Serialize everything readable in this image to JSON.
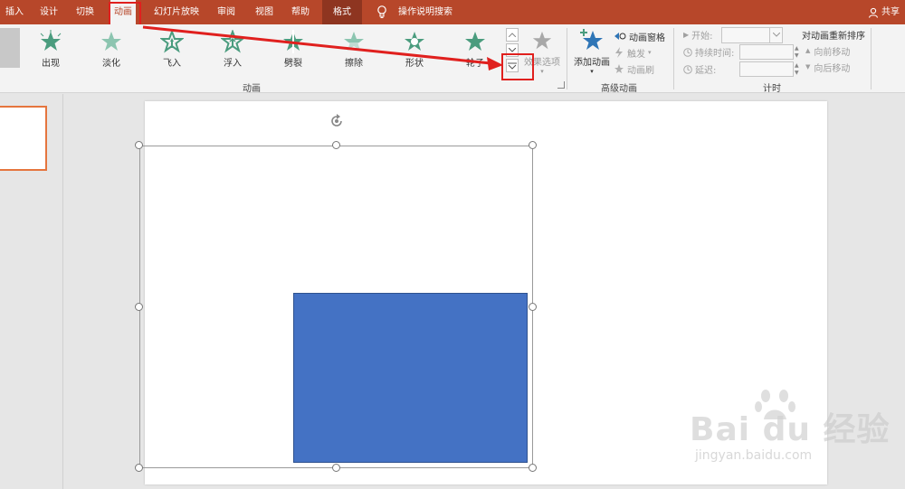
{
  "tabs": [
    {
      "label": "插入"
    },
    {
      "label": "设计"
    },
    {
      "label": "切换"
    },
    {
      "label": "动画"
    },
    {
      "label": "幻灯片放映"
    },
    {
      "label": "审阅"
    },
    {
      "label": "视图"
    },
    {
      "label": "帮助"
    },
    {
      "label": "格式"
    }
  ],
  "tell_me": "操作说明搜索",
  "share": "共享",
  "animations": [
    {
      "label": "出现",
      "icon": "appear-star-icon"
    },
    {
      "label": "淡化",
      "icon": "fade-star-icon"
    },
    {
      "label": "飞入",
      "icon": "fly-in-star-icon"
    },
    {
      "label": "浮入",
      "icon": "float-in-star-icon"
    },
    {
      "label": "劈裂",
      "icon": "split-star-icon"
    },
    {
      "label": "擦除",
      "icon": "wipe-star-icon"
    },
    {
      "label": "形状",
      "icon": "shape-star-icon"
    },
    {
      "label": "轮子",
      "icon": "wheel-star-icon"
    }
  ],
  "effect_options": "效果选项",
  "group_animation": "动画",
  "advanced": {
    "add_animation": "添加动画",
    "pane": "动画窗格",
    "trigger": "触发",
    "painter": "动画刷",
    "group_label": "高级动画"
  },
  "timing": {
    "start": "开始:",
    "duration": "持续时间:",
    "delay": "延迟:",
    "group_label": "计时"
  },
  "reorder": {
    "title": "对动画重新排序",
    "earlier": "向前移动",
    "later": "向后移动"
  },
  "colors": {
    "accent": "#b7472a",
    "shape_fill": "#4472c4",
    "annotation": "#e0201e",
    "star_green": "#4a9c7e"
  },
  "watermark": {
    "brand": "Bai du 经验",
    "url": "jingyan.baidu.com"
  }
}
